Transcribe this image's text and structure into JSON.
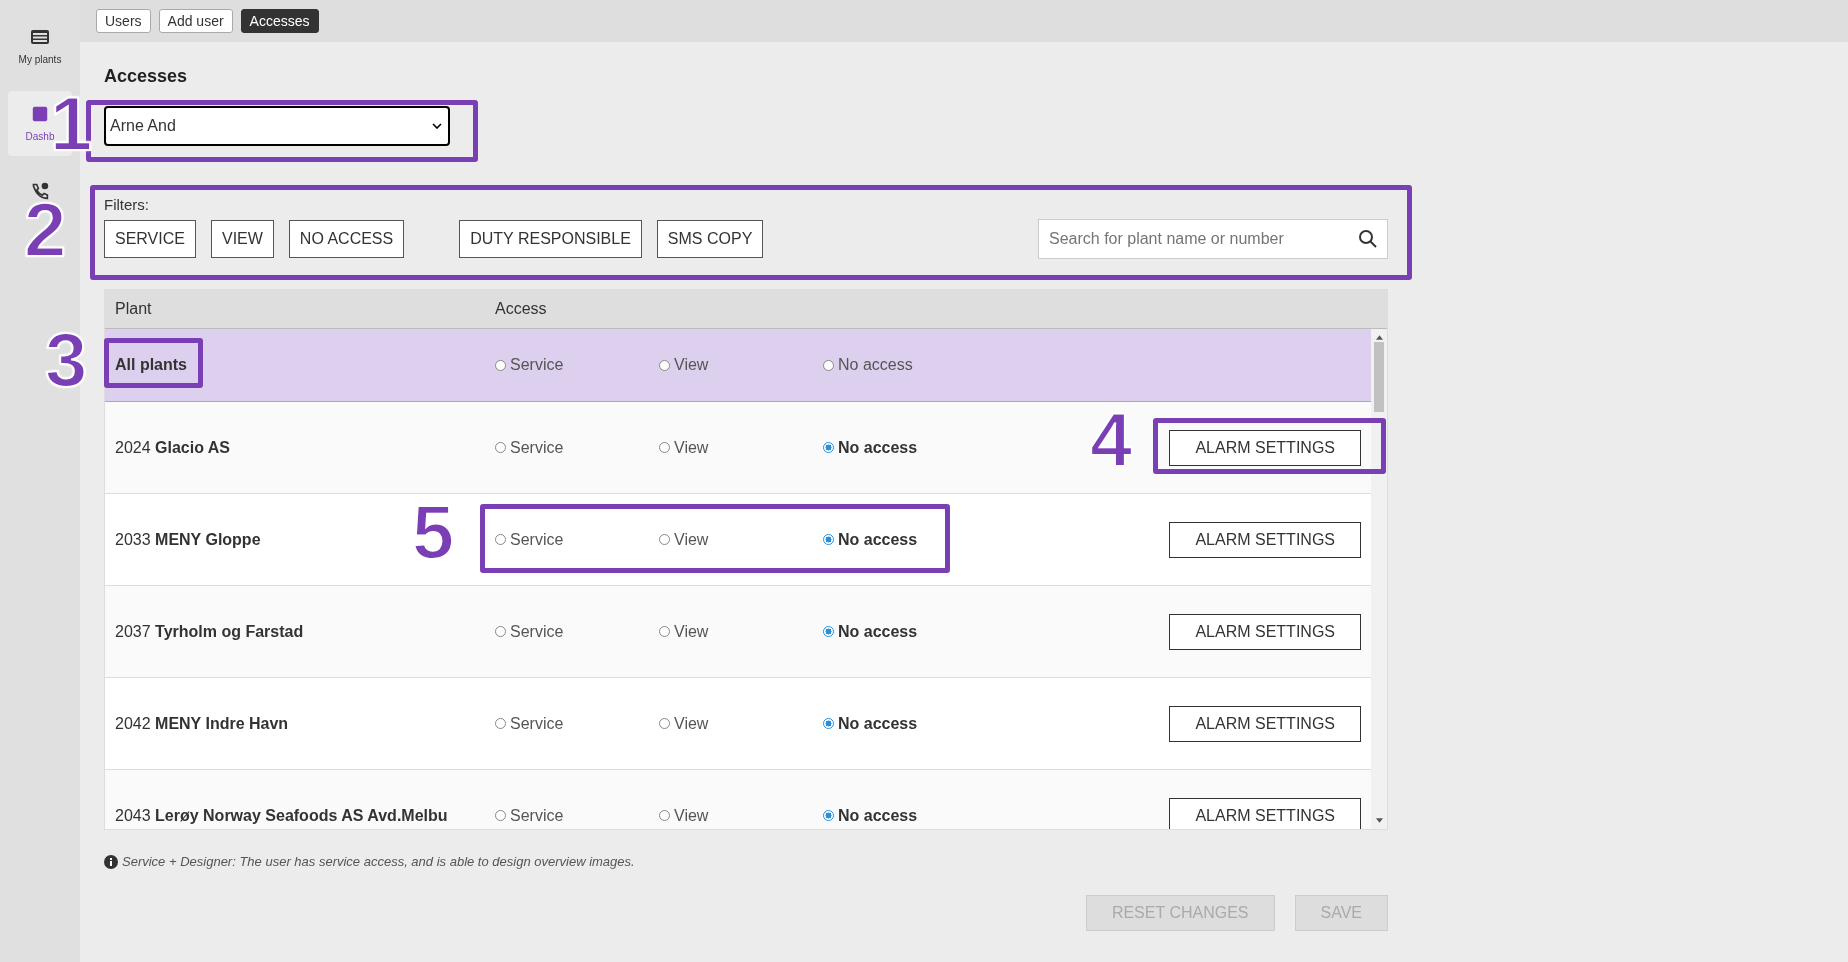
{
  "sidebar": {
    "items": [
      {
        "label": "My plants",
        "selected": false
      },
      {
        "label": "Dashb",
        "selected": true
      },
      {
        "selected": false
      }
    ]
  },
  "tabs": [
    {
      "label": "Users",
      "selected": false
    },
    {
      "label": "Add user",
      "selected": false
    },
    {
      "label": "Accesses",
      "selected": true
    }
  ],
  "title": "Accesses",
  "user_select": {
    "value": "Arne And"
  },
  "filters": {
    "label": "Filters:",
    "buttons": [
      "SERVICE",
      "VIEW",
      "NO ACCESS",
      "DUTY RESPONSIBLE",
      "SMS COPY"
    ],
    "search": {
      "placeholder": "Search for plant name or number"
    }
  },
  "table": {
    "columns": [
      "Plant",
      "Access"
    ],
    "rows": [
      {
        "kind": "all",
        "name": "All plants",
        "options": [
          {
            "label": "Service",
            "selected": false
          },
          {
            "label": "View",
            "selected": false
          },
          {
            "label": "No access",
            "selected": false
          }
        ]
      },
      {
        "kind": "plant",
        "name": "2024 **Glacio AS**",
        "options": [
          {
            "label": "Service",
            "selected": false
          },
          {
            "label": "View",
            "selected": false
          },
          {
            "label": "No access",
            "selected": true
          }
        ],
        "button": "ALARM SETTINGS"
      },
      {
        "kind": "plant",
        "name": "2033 **MENY Gloppe**",
        "options": [
          {
            "label": "Service",
            "selected": false
          },
          {
            "label": "View",
            "selected": false
          },
          {
            "label": "No access",
            "selected": true
          }
        ],
        "button": "ALARM SETTINGS"
      },
      {
        "kind": "plant",
        "name": "2037 **Tyrholm og Farstad**",
        "options": [
          {
            "label": "Service",
            "selected": false
          },
          {
            "label": "View",
            "selected": false
          },
          {
            "label": "No access",
            "selected": true
          }
        ],
        "button": "ALARM SETTINGS"
      },
      {
        "kind": "plant",
        "name": "2042 **MENY Indre Havn**",
        "options": [
          {
            "label": "Service",
            "selected": false
          },
          {
            "label": "View",
            "selected": false
          },
          {
            "label": "No access",
            "selected": true
          }
        ],
        "button": "ALARM SETTINGS"
      },
      {
        "kind": "plant",
        "name": "2043 **Lerøy Norway Seafoods AS Avd.Melbu**",
        "options": [
          {
            "label": "Service",
            "selected": false
          },
          {
            "label": "View",
            "selected": false
          },
          {
            "label": "No access",
            "selected": true
          }
        ],
        "button": "ALARM SETTINGS"
      }
    ]
  },
  "note": "Service + Designer: The user has service access, and is able to design overview images.",
  "actions": [
    {
      "label": "RESET CHANGES",
      "disabled": true
    },
    {
      "label": "SAVE",
      "disabled": true
    }
  ],
  "annotations": [
    {
      "number": "1"
    },
    {
      "number": "2"
    },
    {
      "number": "3"
    },
    {
      "number": "4"
    },
    {
      "number": "5"
    }
  ]
}
